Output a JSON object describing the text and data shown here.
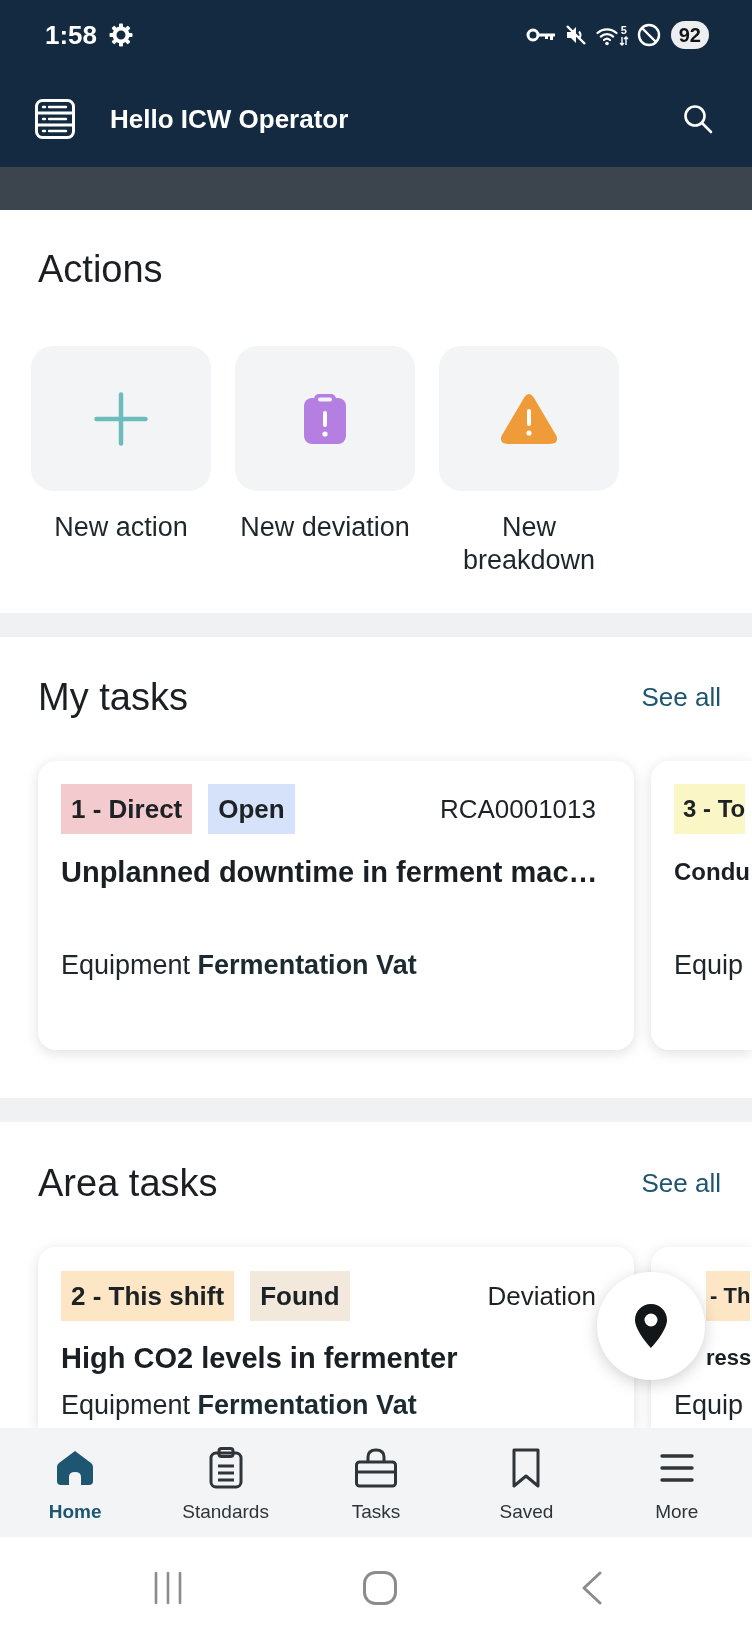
{
  "status_bar": {
    "time": "1:58",
    "wifi_label": "5",
    "battery": "92"
  },
  "app_bar": {
    "title": "Hello ICW Operator"
  },
  "actions": {
    "title": "Actions",
    "items": [
      {
        "kind": "add",
        "label": "New action"
      },
      {
        "kind": "deviation",
        "label": "New deviation"
      },
      {
        "kind": "breakdown",
        "label": "New breakdown"
      }
    ]
  },
  "my_tasks": {
    "title": "My tasks",
    "see_all": "See all",
    "cards": [
      {
        "tags": [
          {
            "text": "1 - Direct",
            "color": "#f3cacd"
          },
          {
            "text": "Open",
            "color": "#d6e2f9"
          }
        ],
        "meta": "RCA0001013",
        "title": "Unplanned downtime in ferment mac…",
        "equipment": "Equipment **Fermentation Vat**"
      },
      {
        "tags": [
          {
            "text": "3 - To",
            "color": "#fbf6c6"
          }
        ],
        "title": "Condu",
        "equipment": "Equip"
      }
    ]
  },
  "area_tasks": {
    "title": "Area tasks",
    "see_all": "See all",
    "cards": [
      {
        "tags": [
          {
            "text": "2 - This shift",
            "color": "#fce6c5"
          },
          {
            "text": "Found",
            "color": "#f2e8dc"
          }
        ],
        "meta": "Deviation",
        "title": "High CO2 levels in fermenter",
        "equipment": "Equipment **Fermentation Vat**"
      },
      {
        "tags": [
          {
            "text": "- Th",
            "color": "#fce6c5"
          }
        ],
        "title": "ress",
        "equipment": "Equip"
      }
    ]
  },
  "bottom_nav": [
    {
      "kind": "home",
      "label": "Home",
      "selected": true
    },
    {
      "kind": "standards",
      "label": "Standards",
      "selected": false
    },
    {
      "kind": "tasks",
      "label": "Tasks",
      "selected": false
    },
    {
      "kind": "saved",
      "label": "Saved",
      "selected": false
    },
    {
      "kind": "more",
      "label": "More",
      "selected": false
    }
  ]
}
